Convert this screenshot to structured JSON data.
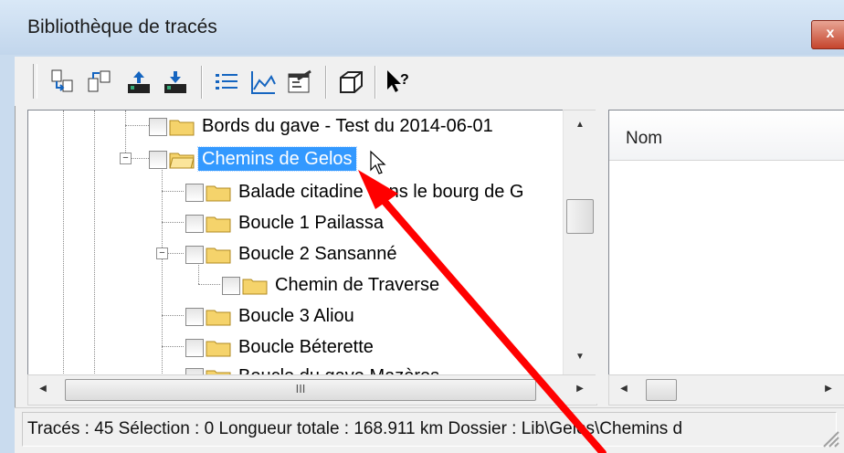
{
  "window": {
    "title": "Bibliothèque de tracés",
    "close_glyph": "x"
  },
  "toolbar": {
    "icons": [
      "import-trace-icon",
      "export-trace-icon",
      "upload-icon",
      "download-icon",
      "list-view-icon",
      "profile-chart-icon",
      "properties-icon",
      "3d-view-icon",
      "help-icon"
    ]
  },
  "tree": {
    "items": [
      {
        "label": "Bords du gave - Test du 2014-06-01",
        "selected": false
      },
      {
        "label": "Chemins de Gelos",
        "selected": true,
        "expander": "−"
      },
      {
        "label": "Balade citadine dans le bourg de G",
        "selected": false
      },
      {
        "label": "Boucle 1 Pailassa",
        "selected": false
      },
      {
        "label": "Boucle 2 Sansanné",
        "selected": false,
        "expander": "−"
      },
      {
        "label": "Chemin de Traverse",
        "selected": false
      },
      {
        "label": "Boucle 3 Aliou",
        "selected": false
      },
      {
        "label": "Boucle Béterette",
        "selected": false
      },
      {
        "label": "Boucle du gave Mazères",
        "selected": false
      }
    ]
  },
  "scroll": {
    "up": "▲",
    "down": "▼",
    "left": "◀",
    "right": "▶",
    "thumb_grip": "III"
  },
  "list": {
    "column_header": "Nom"
  },
  "status": {
    "text": "Tracés : 45 Sélection : 0 Longueur totale : 168.911 km Dossier : Lib\\Gelos\\Chemins d"
  },
  "colors": {
    "selection": "#3399ff",
    "annotation_arrow": "#ff0000",
    "folder": "#f5d36b"
  }
}
